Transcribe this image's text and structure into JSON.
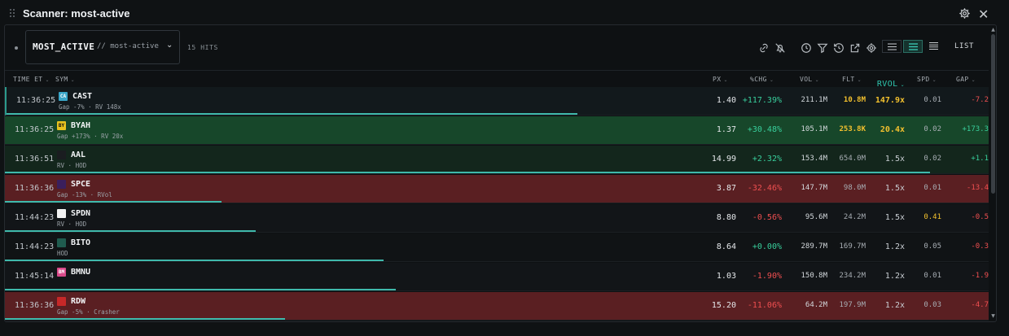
{
  "window": {
    "title": "Scanner: most-active"
  },
  "toolbar": {
    "scanner_name": "MOST_ACTIVE",
    "scanner_sub": "// most-active",
    "hits": "15 HITS",
    "list_label": "LIST",
    "icons": [
      "link-icon",
      "bell-off-icon",
      "clock-icon",
      "filter-icon",
      "history-icon",
      "external-link-icon",
      "settings-icon"
    ]
  },
  "columns": {
    "time": "TIME ET",
    "sym": "SYM",
    "px": "PX",
    "chg": "%CHG",
    "vol": "VOL",
    "flt": "FLT",
    "rvol": "RVOL",
    "spd": "SPD",
    "gap": "GAP"
  },
  "colors": {
    "accent": "#2fc7b0",
    "up": "#38cf9c",
    "down": "#ef4f50",
    "highlight": "#f2c02e"
  },
  "rows": [
    {
      "time": "11:36:25",
      "logo": "CA",
      "logo_bg": "#3aa6c8",
      "sym": "CAST",
      "tags": "Gap -7% · RV 148x",
      "px": "1.40",
      "chg": "+117.39%",
      "vol": "211.1M",
      "flt": "10.8M",
      "rvol": "147.9x",
      "spd": "0.01",
      "gap": "-7.2",
      "progress": 0.58
    },
    {
      "time": "11:36:25",
      "logo": "BY",
      "logo_bg": "#e8c21f",
      "sym": "BYAH",
      "tags": "Gap +173% · RV 20x",
      "px": "1.37",
      "chg": "+30.48%",
      "vol": "105.1M",
      "flt": "253.8K",
      "rvol": "20.4x",
      "spd": "0.02",
      "gap": "+173.3",
      "progress": 0.0
    },
    {
      "time": "11:36:51",
      "logo": "",
      "logo_bg": "#1a1d20",
      "sym": "AAL",
      "tags": "RV · HOD",
      "px": "14.99",
      "chg": "+2.32%",
      "vol": "153.4M",
      "flt": "654.0M",
      "rvol": "1.5x",
      "spd": "0.02",
      "gap": "+1.1",
      "progress": 0.94
    },
    {
      "time": "11:36:36",
      "logo": "",
      "logo_bg": "#3a1f5c",
      "sym": "SPCE",
      "tags": "Gap -13% · RVol",
      "px": "3.87",
      "chg": "-32.46%",
      "vol": "147.7M",
      "flt": "98.0M",
      "rvol": "1.5x",
      "spd": "0.01",
      "gap": "-13.4",
      "progress": 0.22
    },
    {
      "time": "11:44:23",
      "logo": "",
      "logo_bg": "#f2f2f2",
      "sym": "SPDN",
      "tags": "RV · HOD",
      "px": "8.80",
      "chg": "-0.56%",
      "vol": "95.6M",
      "flt": "24.2M",
      "rvol": "1.5x",
      "spd": "0.41",
      "gap": "-0.5",
      "progress": 0.255
    },
    {
      "time": "11:44:23",
      "logo": "",
      "logo_bg": "#1f5c4f",
      "sym": "BITO",
      "tags": "HOD",
      "px": "8.64",
      "chg": "+0.00%",
      "vol": "289.7M",
      "flt": "169.7M",
      "rvol": "1.2x",
      "spd": "0.05",
      "gap": "-0.3",
      "progress": 0.385
    },
    {
      "time": "11:45:14",
      "logo": "BM",
      "logo_bg": "#d94a8a",
      "sym": "BMNU",
      "tags": "",
      "px": "1.03",
      "chg": "-1.90%",
      "vol": "150.8M",
      "flt": "234.2M",
      "rvol": "1.2x",
      "spd": "0.01",
      "gap": "-1.9",
      "progress": 0.397
    },
    {
      "time": "11:36:36",
      "logo": "",
      "logo_bg": "#c62828",
      "sym": "RDW",
      "tags": "Gap -5% · Crasher",
      "px": "15.20",
      "chg": "-11.06%",
      "vol": "64.2M",
      "flt": "197.9M",
      "rvol": "1.2x",
      "spd": "0.03",
      "gap": "-4.7",
      "progress": 0.285
    }
  ]
}
